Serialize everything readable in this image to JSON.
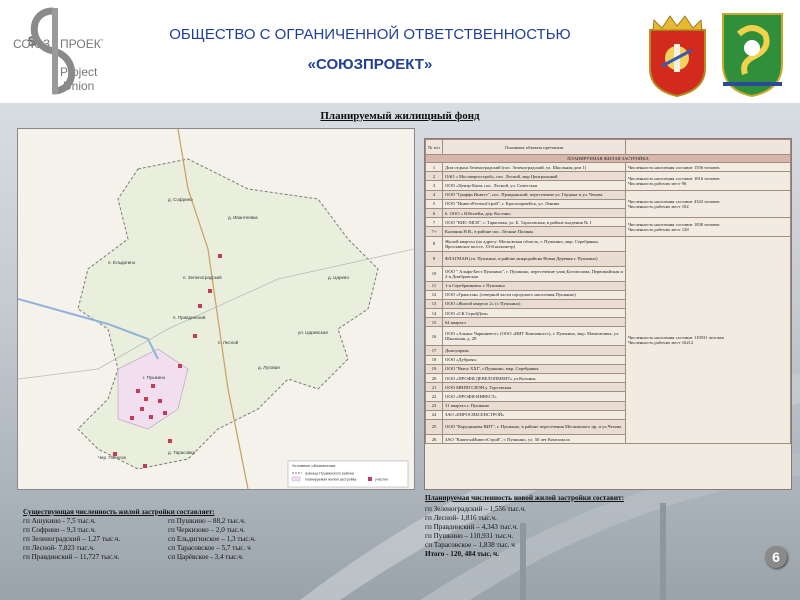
{
  "header": {
    "title_line1": "ОБЩЕСТВО С ОГРАНИЧЕННОЙ ОТВЕТСТВЕННОСТЬЮ",
    "title_line2": "«СОЮЗПРОЕКТ»",
    "logo_text_left": "СОЮЗ",
    "logo_text_right": "ПРОЕКТ",
    "logo_text_en1": "Project",
    "logo_text_en2": "Union",
    "accent": "#1f3f9a"
  },
  "plan_title": "Планируемый жилищный фонд",
  "map": {
    "labels": [
      "д. Ивантеевка",
      "д. Софрино",
      "п. Ельдигино",
      "п. Зеленоградский",
      "п. Правдинский",
      "п. Лесной",
      "д. Тарасовка",
      "г. Пушкино",
      "ул. Царевская",
      "Чер. Поселок",
      "д. Цаpевo",
      "д. Луговая"
    ],
    "legend_title": "Условные обозначения",
    "legend_items": [
      "граница Пушкинского района",
      "планируемая жилая застройка",
      "участки"
    ]
  },
  "table": {
    "header_num": "№ п/п",
    "header_obj": "Основные объекты претензии",
    "section": "ПЛАНИРУЕМАЯ ЖИЛАЯ ЗАСТРОЙКА",
    "rows": [
      {
        "n": "1",
        "t": "Дом отдыха Зеленоградский (пос. Зеленоградский, ул. Школьная дом 1)"
      },
      {
        "n": "2",
        "t": "ОАО « Мосэнергострой», пос. Лесной, мкр Центральный"
      },
      {
        "n": "3",
        "t": "ООО «Центр-Капи, пос. Лесной, ул. Советская"
      },
      {
        "n": "4",
        "t": "ООО \"Граффа Инвест\", пос. Правдинский, пересечение ул. Герцена и ул. Чехова"
      },
      {
        "n": "5",
        "t": "ООО \"ИнвестРегионСтрой\", г. Красноармейск, ул. Ленина"
      },
      {
        "n": "6",
        "t": "6. ООО « Юбилейн, дер. Костино"
      },
      {
        "n": "7",
        "t": "ООО \"КИС-МСК\", г. Тарасовка, ул. Б. Тарасовская, в районе владения № 1"
      },
      {
        "n": "7+",
        "t": "Калинин Н.В., в районе пос. Лесные Поляны"
      },
      {
        "n": "8",
        "t": "Жилой квартал (по адресу: Московская область, г. Пушкино, мкр. Серебрянка, Ярославское шоссе, 33-й километр)"
      },
      {
        "n": "9",
        "t": "ФЛАГМАН (гп. Пушкино, в районе микрорайона Новая Деревня г. Пушкино)"
      },
      {
        "n": "10",
        "t": "ООО \" Альфа-Бест Пушкино\", г. Пушкино, пересечение улиц Богомолова, Первомайская и 2-я Домбровская"
      },
      {
        "n": "11",
        "t": "1-я Серебрянковск г. Пушкино"
      },
      {
        "n": "12",
        "t": "ООО «Гранстан» (северной части городского населения Пушкино)"
      },
      {
        "n": "13",
        "t": "ООО «Жилой квартал 2» (г. Пушкино)"
      },
      {
        "n": "14",
        "t": "ООО «СК СтройДом»"
      },
      {
        "n": "15",
        "t": "64 квартал"
      },
      {
        "n": "16",
        "t": "ООО «Альянс Чаркинвест» (ООО «ВИТ Компанистс), г. Пушкино, мкр. Мамонтовка, ул. Школьная, д. 28"
      },
      {
        "n": "17",
        "t": "Домоуправа"
      },
      {
        "n": "18",
        "t": "ООО «Дубрава»"
      },
      {
        "n": "19",
        "t": "ООО \"Вьюу ХХI\", г.Пушкино, мкр. Серебрянка"
      },
      {
        "n": "20",
        "t": "ООО «ПРОФИ ДЕВЕЛОПМЕНТ» ул.Колонья"
      },
      {
        "n": "21",
        "t": "ООО МНПП СИЭН у. Турсевская"
      },
      {
        "n": "22",
        "t": "ООО «ПРОФИ-ИНВЕСТ»"
      },
      {
        "n": "23",
        "t": "31 квартал г. Пушкино"
      },
      {
        "n": "24",
        "t": "ЗАО «ЕВРОСИБСЕВСТРОЙ»"
      },
      {
        "n": "25",
        "t": "ООО \"Карущинова ВИТ\", г. Пушкино, в районе пересечения Московского пр. и ул.Чехова"
      },
      {
        "n": "26",
        "t": "ЗАО \"КапиталИнвестСтрой\", г. Пушкино, ул. 50 лет Комсомола"
      }
    ],
    "merged": [
      {
        "line1": "Численность населения составит 1556 человек",
        "line2": ""
      },
      {
        "line1": "Численность населения составит 1816 человек",
        "line2": "Численность рабочих мест 96"
      },
      {
        "line1": "Численность населения составит 4343 человек",
        "line2": "Численность рабочих мест 102"
      },
      {
        "line1": "Численность населения составит 1838 человек",
        "line2": "Численность рабочих мест 128"
      },
      {
        "line1": "Численность населения составит 110931 человек",
        "line2": "Численность рабочих мест 16212"
      }
    ]
  },
  "existing": {
    "heading": "Существующая численность жилой застройки составляет:",
    "items": [
      "гп Ашукино - 7,5 тыс.ч.",
      "гп Пушкино – 88,2 тыс.ч.",
      "гп Софрино – 9,3 тыс.ч.",
      "гп Черкизово – 2,0 тыс.ч.",
      "гп Зеленоградский – 1,27 тыс.ч.",
      "сп Ельдигинское – 1,3 тыс.ч.",
      "гп Лесной- 7,823 тыс.ч.",
      "сп Тарасовское – 5,7 тыс. ч",
      "гп Правдинский – 11,727 тыс.ч.",
      "сп Царёвское - 3,4 тыс.ч."
    ]
  },
  "planned": {
    "heading": "Планируемая численность новой жилой застройки составит:",
    "items": [
      "гп Зеленоградский – 1,556 тыс.ч.",
      "гп Лесной- 1,816 тыс.ч.",
      "гп Правдинский – 4,343 тыс.ч.",
      "гп Пушкино – 110,931 тыс.ч.",
      "сп Тарасовское – 1,838 тыс. ч"
    ],
    "total": "Итого - 120, 484 тыс. ч."
  },
  "page_number": "6"
}
